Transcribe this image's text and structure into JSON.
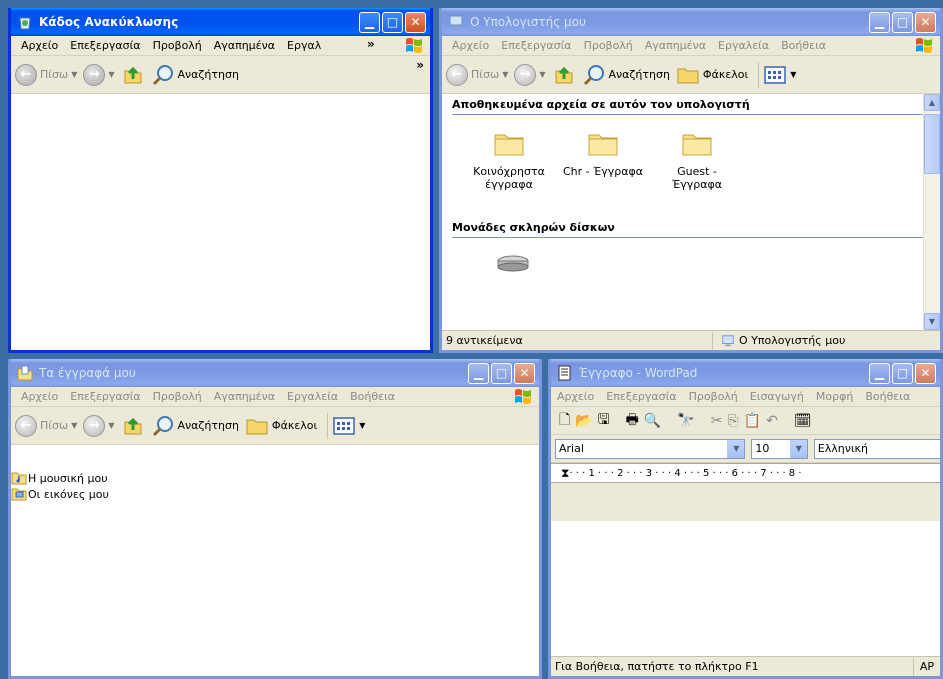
{
  "recycle": {
    "title": "Κάδος Ανακύκλωσης",
    "menu": [
      "Αρχείο",
      "Επεξεργασία",
      "Προβολή",
      "Αγαπημένα",
      "Εργαλ"
    ],
    "back": "Πίσω",
    "search": "Αναζήτηση"
  },
  "computer": {
    "title": "Ο Υπολογιστής μου",
    "menu": [
      "Αρχείο",
      "Επεξεργασία",
      "Προβολή",
      "Αγαπημένα",
      "Εργαλεία",
      "Βοήθεια"
    ],
    "back": "Πίσω",
    "search": "Αναζήτηση",
    "folders_btn": "Φάκελοι",
    "section1": "Αποθηκευμένα αρχεία σε αυτόν τον υπολογιστή",
    "folders": [
      {
        "line1": "Κοινόχρηστα",
        "line2": "έγγραφα"
      },
      {
        "line1": "Chr - Έγγραφα",
        "line2": ""
      },
      {
        "line1": "Guest -",
        "line2": "Έγγραφα"
      }
    ],
    "section2": "Μονάδες σκληρών δίσκων",
    "status_left": "9 αντικείμενα",
    "status_right": "Ο Υπολογιστής μου"
  },
  "docs": {
    "title": "Τα έγγραφά μου",
    "menu": [
      "Αρχείο",
      "Επεξεργασία",
      "Προβολή",
      "Αγαπημένα",
      "Εργαλεία",
      "Βοήθεια"
    ],
    "back": "Πίσω",
    "search": "Αναζήτηση",
    "folders_btn": "Φάκελοι",
    "items": [
      "Η μουσική μου",
      "Οι εικόνες μου"
    ]
  },
  "wordpad": {
    "title": "Έγγραφο - WordPad",
    "menu": [
      "Αρχείο",
      "Επεξεργασία",
      "Προβολή",
      "Εισαγωγή",
      "Μορφή",
      "Βοήθεια"
    ],
    "font": "Arial",
    "size": "10",
    "script": "Ελληνική",
    "ruler": "· · · 1 · · · 2 · · · 3 · · · 4 · · · 5 · · · 6 · · · 7 · · · 8 ·",
    "status": "Για Βοήθεια, πατήστε το πλήκτρο F1",
    "status_cap": "AP"
  }
}
